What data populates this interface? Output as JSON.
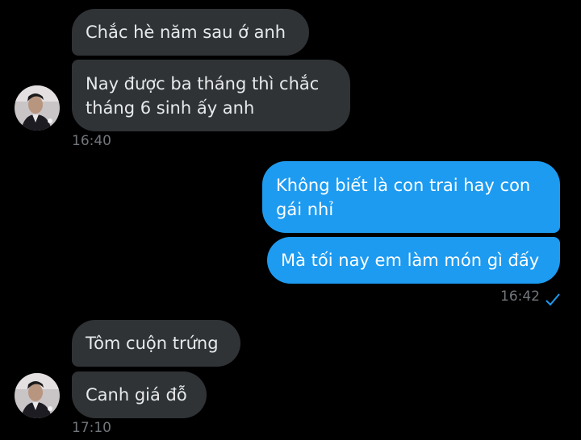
{
  "conversation": {
    "messages": [
      {
        "direction": "incoming",
        "text": "Chắc hè năm sau ớ anh"
      },
      {
        "direction": "incoming",
        "text": "Nay được ba tháng thì chắc tháng 6 sinh ấy anh"
      },
      {
        "direction": "outgoing",
        "text": "Không biết là con trai hay con gái nhỉ"
      },
      {
        "direction": "outgoing",
        "text": "Mà tối nay em làm món gì đấy"
      },
      {
        "direction": "incoming",
        "text": "Tôm cuộn trứng"
      },
      {
        "direction": "incoming",
        "text": "Canh giá đỗ"
      }
    ],
    "timestamps": {
      "group1": "16:40",
      "group2": "16:42",
      "group3": "17:10"
    },
    "status": {
      "group2_read": "sent-check-icon"
    }
  },
  "theme": {
    "background": "#000000",
    "incoming_bubble": "#2f3336",
    "outgoing_bubble": "#1d9bf0",
    "timestamp_color": "#71767b",
    "check_color": "#1d9bf0"
  }
}
